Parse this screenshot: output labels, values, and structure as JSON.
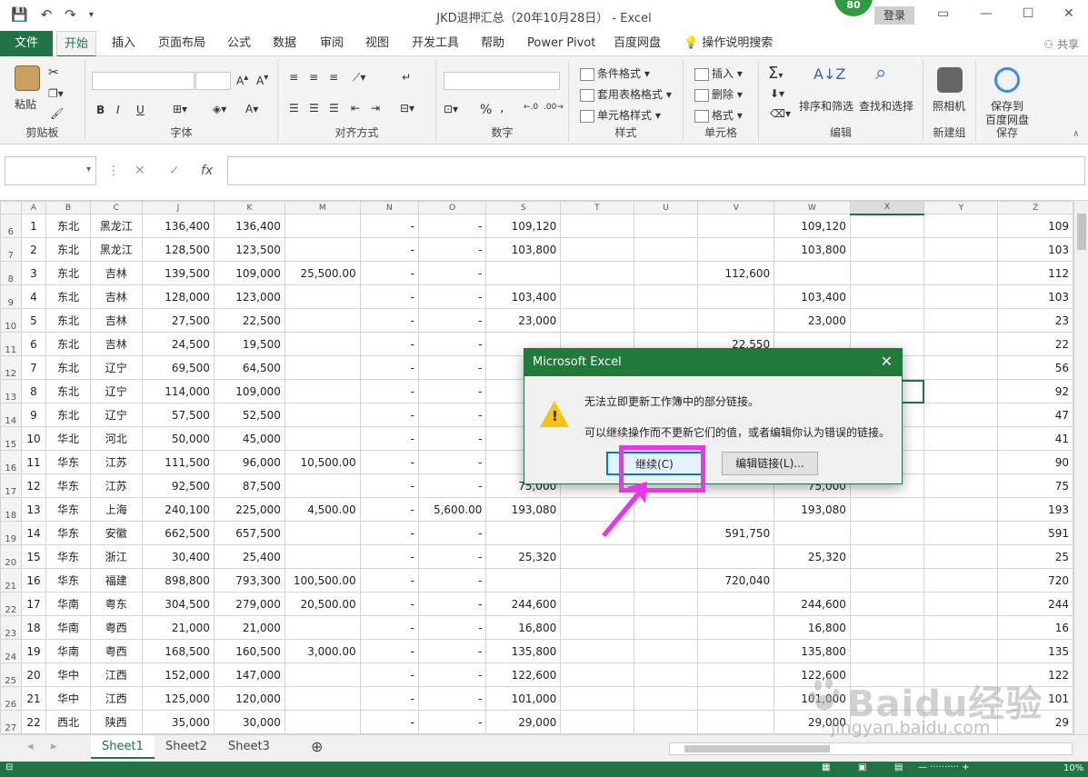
{
  "window": {
    "title": "JKD退押汇总（20年10月28日） - Excel",
    "login_label": "登录",
    "badge_value": "80",
    "share_label": "共享"
  },
  "tabs": [
    "文件",
    "开始",
    "插入",
    "页面布局",
    "公式",
    "数据",
    "审阅",
    "视图",
    "开发工具",
    "帮助",
    "Power Pivot",
    "百度网盘",
    "操作说明搜索"
  ],
  "ribbon": {
    "clipboard": {
      "group": "剪贴板",
      "paste": "粘贴"
    },
    "font": {
      "group": "字体",
      "bold": "B",
      "italic": "I",
      "underline": "U"
    },
    "alignment": {
      "group": "对齐方式"
    },
    "number": {
      "group": "数字",
      "percent": "%",
      "comma": ","
    },
    "styles": {
      "group": "样式",
      "conditional": "条件格式",
      "table": "套用表格格式",
      "cell": "单元格样式"
    },
    "cells": {
      "group": "单元格",
      "insert": "插入",
      "delete": "删除",
      "format": "格式"
    },
    "editing": {
      "group": "编辑",
      "sort": "排序和筛选",
      "find": "查找和选择"
    },
    "new_group": {
      "group": "新建组",
      "camera": "照相机"
    },
    "save": {
      "group": "保存",
      "save_to": "保存到",
      "baidu": "百度网盘"
    }
  },
  "formula_bar": {
    "fx": "fx",
    "cancel": "✕",
    "confirm": "✓"
  },
  "columns": [
    "A",
    "B",
    "C",
    "J",
    "K",
    "M",
    "N",
    "O",
    "S",
    "T",
    "U",
    "V",
    "W",
    "X",
    "Y",
    "Z"
  ],
  "selected_column": "X",
  "rows": [
    {
      "n": "6",
      "a": "1",
      "b": "东北",
      "c": "黑龙江",
      "j": "136,400",
      "k": "136,400",
      "m": "",
      "n2": "-",
      "o": "-",
      "s": "109,120",
      "t": "",
      "u": "",
      "v": "",
      "w": "109,120",
      "x": "",
      "y": "",
      "z": "109"
    },
    {
      "n": "7",
      "a": "2",
      "b": "东北",
      "c": "黑龙江",
      "j": "128,500",
      "k": "123,500",
      "m": "",
      "n2": "-",
      "o": "-",
      "s": "103,800",
      "t": "",
      "u": "",
      "v": "",
      "w": "103,800",
      "x": "",
      "y": "",
      "z": "103"
    },
    {
      "n": "8",
      "a": "3",
      "b": "东北",
      "c": "吉林",
      "j": "139,500",
      "k": "109,000",
      "m": "25,500.00",
      "n2": "-",
      "o": "-",
      "s": "",
      "t": "",
      "u": "",
      "v": "112,600",
      "w": "",
      "x": "",
      "y": "",
      "z": "112"
    },
    {
      "n": "9",
      "a": "4",
      "b": "东北",
      "c": "吉林",
      "j": "128,000",
      "k": "123,000",
      "m": "",
      "n2": "-",
      "o": "-",
      "s": "103,400",
      "t": "",
      "u": "",
      "v": "",
      "w": "103,400",
      "x": "",
      "y": "",
      "z": "103"
    },
    {
      "n": "10",
      "a": "5",
      "b": "东北",
      "c": "吉林",
      "j": "27,500",
      "k": "22,500",
      "m": "",
      "n2": "-",
      "o": "-",
      "s": "23,000",
      "t": "",
      "u": "",
      "v": "",
      "w": "23,000",
      "x": "",
      "y": "",
      "z": "23"
    },
    {
      "n": "11",
      "a": "6",
      "b": "东北",
      "c": "吉林",
      "j": "24,500",
      "k": "19,500",
      "m": "",
      "n2": "-",
      "o": "-",
      "s": "",
      "t": "",
      "u": "",
      "v": "22,550",
      "w": "",
      "x": "",
      "y": "",
      "z": "22"
    },
    {
      "n": "12",
      "a": "7",
      "b": "东北",
      "c": "辽宁",
      "j": "69,500",
      "k": "64,500",
      "m": "",
      "n2": "-",
      "o": "-",
      "s": "",
      "t": "",
      "u": "",
      "v": "",
      "w": "",
      "x": "",
      "y": "",
      "z": "56"
    },
    {
      "n": "13",
      "a": "8",
      "b": "东北",
      "c": "辽宁",
      "j": "114,000",
      "k": "109,000",
      "m": "",
      "n2": "-",
      "o": "-",
      "s": "",
      "t": "",
      "u": "",
      "v": "",
      "w": "",
      "x": "",
      "y": "",
      "z": "92"
    },
    {
      "n": "14",
      "a": "9",
      "b": "东北",
      "c": "辽宁",
      "j": "57,500",
      "k": "52,500",
      "m": "",
      "n2": "-",
      "o": "-",
      "s": "",
      "t": "",
      "u": "",
      "v": "",
      "w": "",
      "x": "",
      "y": "",
      "z": "47"
    },
    {
      "n": "15",
      "a": "10",
      "b": "华北",
      "c": "河北",
      "j": "50,000",
      "k": "45,000",
      "m": "",
      "n2": "-",
      "o": "-",
      "s": "",
      "t": "",
      "u": "",
      "v": "",
      "w": "",
      "x": "",
      "y": "",
      "z": "41"
    },
    {
      "n": "16",
      "a": "11",
      "b": "华东",
      "c": "江苏",
      "j": "111,500",
      "k": "96,000",
      "m": "10,500.00",
      "n2": "-",
      "o": "-",
      "s": "",
      "t": "",
      "u": "",
      "v": "",
      "w": "",
      "x": "",
      "y": "",
      "z": "90"
    },
    {
      "n": "17",
      "a": "12",
      "b": "华东",
      "c": "江苏",
      "j": "92,500",
      "k": "87,500",
      "m": "",
      "n2": "-",
      "o": "-",
      "s": "75,000",
      "t": "",
      "u": "",
      "v": "",
      "w": "75,000",
      "x": "",
      "y": "",
      "z": "75"
    },
    {
      "n": "18",
      "a": "13",
      "b": "华东",
      "c": "上海",
      "j": "240,100",
      "k": "225,000",
      "m": "4,500.00",
      "n2": "-",
      "o": "5,600.00",
      "s": "193,080",
      "t": "",
      "u": "",
      "v": "",
      "w": "193,080",
      "x": "",
      "y": "",
      "z": "193"
    },
    {
      "n": "19",
      "a": "14",
      "b": "华东",
      "c": "安徽",
      "j": "662,500",
      "k": "657,500",
      "m": "",
      "n2": "-",
      "o": "-",
      "s": "",
      "t": "",
      "u": "",
      "v": "591,750",
      "w": "",
      "x": "",
      "y": "",
      "z": "591"
    },
    {
      "n": "20",
      "a": "15",
      "b": "华东",
      "c": "浙江",
      "j": "30,400",
      "k": "25,400",
      "m": "",
      "n2": "-",
      "o": "-",
      "s": "25,320",
      "t": "",
      "u": "",
      "v": "",
      "w": "25,320",
      "x": "",
      "y": "",
      "z": "25"
    },
    {
      "n": "21",
      "a": "16",
      "b": "华东",
      "c": "福建",
      "j": "898,800",
      "k": "793,300",
      "m": "100,500.00",
      "n2": "-",
      "o": "-",
      "s": "",
      "t": "",
      "u": "",
      "v": "720,040",
      "w": "",
      "x": "",
      "y": "",
      "z": "720"
    },
    {
      "n": "22",
      "a": "17",
      "b": "华南",
      "c": "粤东",
      "j": "304,500",
      "k": "279,000",
      "m": "20,500.00",
      "n2": "-",
      "o": "-",
      "s": "244,600",
      "t": "",
      "u": "",
      "v": "",
      "w": "244,600",
      "x": "",
      "y": "",
      "z": "244"
    },
    {
      "n": "23",
      "a": "18",
      "b": "华南",
      "c": "粤西",
      "j": "21,000",
      "k": "21,000",
      "m": "",
      "n2": "-",
      "o": "-",
      "s": "16,800",
      "t": "",
      "u": "",
      "v": "",
      "w": "16,800",
      "x": "",
      "y": "",
      "z": "16"
    },
    {
      "n": "24",
      "a": "19",
      "b": "华南",
      "c": "粤西",
      "j": "168,500",
      "k": "160,500",
      "m": "3,000.00",
      "n2": "-",
      "o": "-",
      "s": "135,800",
      "t": "",
      "u": "",
      "v": "",
      "w": "135,800",
      "x": "",
      "y": "",
      "z": "135"
    },
    {
      "n": "25",
      "a": "20",
      "b": "华中",
      "c": "江西",
      "j": "152,000",
      "k": "147,000",
      "m": "",
      "n2": "-",
      "o": "-",
      "s": "122,600",
      "t": "",
      "u": "",
      "v": "",
      "w": "122,600",
      "x": "",
      "y": "",
      "z": "122"
    },
    {
      "n": "26",
      "a": "21",
      "b": "华中",
      "c": "江西",
      "j": "125,000",
      "k": "120,000",
      "m": "",
      "n2": "-",
      "o": "-",
      "s": "101,000",
      "t": "",
      "u": "",
      "v": "",
      "w": "101,000",
      "x": "",
      "y": "",
      "z": "101"
    },
    {
      "n": "27",
      "a": "22",
      "b": "西北",
      "c": "陕西",
      "j": "35,000",
      "k": "30,000",
      "m": "",
      "n2": "-",
      "o": "-",
      "s": "29,000",
      "t": "",
      "u": "",
      "v": "",
      "w": "29,000",
      "x": "",
      "y": "",
      "z": "29"
    }
  ],
  "sheets": [
    "Sheet1",
    "Sheet2",
    "Sheet3"
  ],
  "active_sheet": "Sheet1",
  "status": {
    "zoom": "10%"
  },
  "dialog": {
    "title": "Microsoft Excel",
    "message1": "无法立即更新工作簿中的部分链接。",
    "message2": "可以继续操作而不更新它们的值，或者编辑你认为错误的链接。",
    "continue_label": "继续(C)",
    "edit_links_label": "编辑链接(L)..."
  },
  "watermark": {
    "brand": "Baidu经验",
    "url": "jingyan.baidu.com"
  },
  "colors": {
    "excel_green": "#217346",
    "highlight": "#ee33ee",
    "warning": "#f3c315"
  }
}
